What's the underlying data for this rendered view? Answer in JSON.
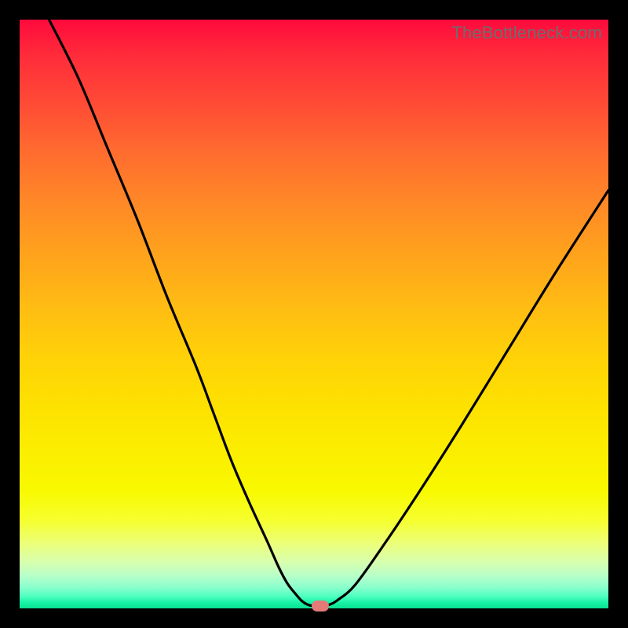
{
  "watermark": "TheBottleneck.com",
  "colors": {
    "marker": "#e37a77",
    "curve": "#000000"
  },
  "chart_data": {
    "type": "line",
    "title": "",
    "xlabel": "",
    "ylabel": "",
    "xlim": [
      0,
      100
    ],
    "ylim": [
      0,
      100
    ],
    "grid": false,
    "series": [
      {
        "name": "bottleneck_curve",
        "x": [
          5,
          10,
          15,
          20,
          25,
          30,
          33,
          36,
          39,
          42,
          44,
          45.5,
          47,
          48,
          49,
          50,
          51,
          52.5,
          54,
          57,
          62,
          68,
          75,
          83,
          91,
          100
        ],
        "y": [
          100,
          90,
          78,
          66,
          53,
          41,
          33,
          25,
          18,
          11.5,
          7,
          4.2,
          2.3,
          1.2,
          0.6,
          0.4,
          0.4,
          0.6,
          1.4,
          4,
          11,
          20,
          31,
          44,
          57,
          71
        ]
      }
    ],
    "marker": {
      "x": 51,
      "y": 0.4
    }
  }
}
